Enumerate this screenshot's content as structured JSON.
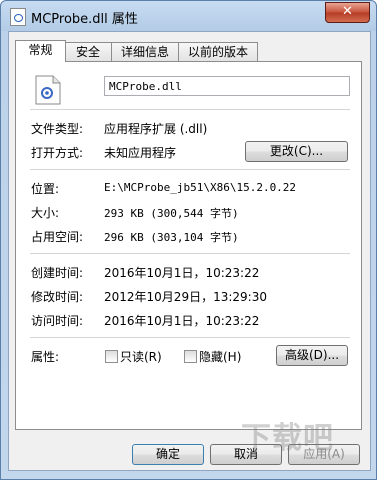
{
  "window": {
    "title": "MCProbe.dll 属性",
    "close_label": "✕"
  },
  "tabs": [
    {
      "label": "常规"
    },
    {
      "label": "安全"
    },
    {
      "label": "详细信息"
    },
    {
      "label": "以前的版本"
    }
  ],
  "general": {
    "file_name": "MCProbe.dll",
    "file_type_label": "文件类型:",
    "file_type_value": "应用程序扩展 (.dll)",
    "open_with_label": "打开方式:",
    "open_with_value": "未知应用程序",
    "change_button": "更改(C)...",
    "location_label": "位置:",
    "location_value": "E:\\MCProbe_jb51\\X86\\15.2.0.22",
    "size_label": "大小:",
    "size_value": "293 KB (300,544 字节)",
    "size_on_disk_label": "占用空间:",
    "size_on_disk_value": "296 KB (303,104 字节)",
    "created_label": "创建时间:",
    "created_value": "2016年10月1日，10:23:22",
    "modified_label": "修改时间:",
    "modified_value": "2012年10月29日，13:29:30",
    "accessed_label": "访问时间:",
    "accessed_value": "2016年10月1日，10:23:22",
    "attributes_label": "属性:",
    "readonly_label": "只读(R)",
    "hidden_label": "隐藏(H)",
    "advanced_button": "高级(D)..."
  },
  "footer": {
    "ok": "确定",
    "cancel": "取消",
    "apply": "应用(A)"
  },
  "watermark": "下载吧"
}
